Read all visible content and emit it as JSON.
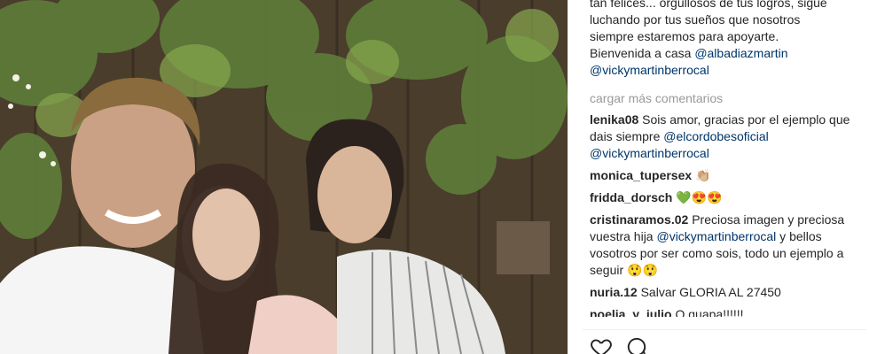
{
  "caption": {
    "lines": [
      "tan felices... orgullosos de tus logros, sigue",
      "luchando por tus sueños que nosotros",
      "siempre estaremos para apoyarte."
    ],
    "welcome_text": "Bienvenida a casa ",
    "mention_1": "@albadiazmartin",
    "mention_2": "@vickymartinberrocal"
  },
  "load_more": "cargar más comentarios",
  "comments": [
    {
      "user": "lenika08",
      "text": "Sois amor, gracias por el ejemplo que dais siempre ",
      "mention": "@elcordobesoficial",
      "mention2": "@vickymartinberrocal",
      "tail": ""
    },
    {
      "user": "monica_tupersex",
      "text": "👏🏼",
      "mention": "",
      "mention2": "",
      "tail": ""
    },
    {
      "user": "fridda_dorsch",
      "text": "💚😍😍",
      "mention": "",
      "mention2": "",
      "tail": ""
    },
    {
      "user": "cristinaramos.02",
      "text": "Preciosa imagen y preciosa vuestra hija ",
      "mention": "@vickymartinberrocal",
      "mention2": "",
      "tail": " y bellos vosotros por ser como sois, todo un ejemplo a seguir 😲😲"
    },
    {
      "user": "nuria.12",
      "text": "Salvar GLORIA AL 27450",
      "mention": "",
      "mention2": "",
      "tail": ""
    },
    {
      "user": "noelia_y_julio",
      "text": "O guapa!!!!!!",
      "mention": "",
      "mention2": "",
      "tail": ""
    }
  ],
  "icons": {
    "like": "heart-icon",
    "comment": "comment-icon"
  }
}
